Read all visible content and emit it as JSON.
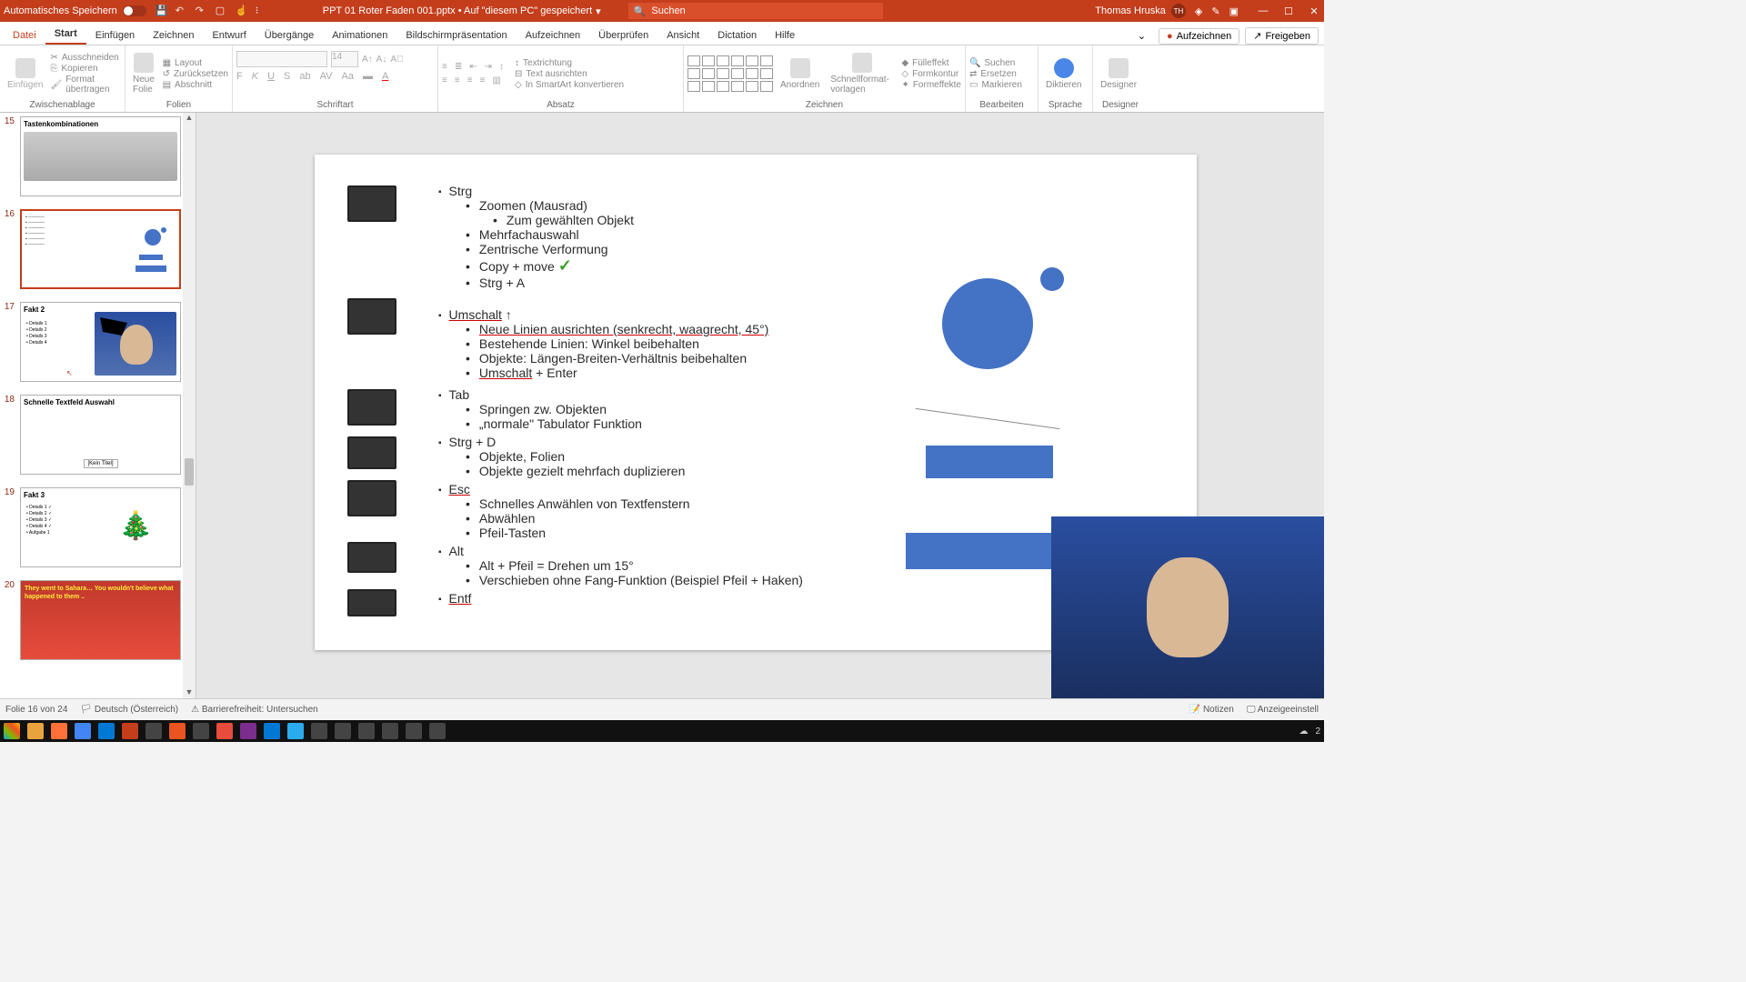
{
  "titlebar": {
    "autosave_label": "Automatisches Speichern",
    "doc_title": "PPT 01 Roter Faden 001.pptx • Auf \"diesem PC\" gespeichert",
    "search_placeholder": "Suchen",
    "user_name": "Thomas Hruska",
    "user_initials": "TH"
  },
  "tabs": {
    "file": "Datei",
    "items": [
      "Start",
      "Einfügen",
      "Zeichnen",
      "Entwurf",
      "Übergänge",
      "Animationen",
      "Bildschirmpräsentation",
      "Aufzeichnen",
      "Überprüfen",
      "Ansicht",
      "Dictation",
      "Hilfe"
    ],
    "active_index": 0,
    "record_btn": "Aufzeichnen",
    "share_btn": "Freigeben"
  },
  "ribbon": {
    "clipboard": {
      "label": "Zwischenablage",
      "paste": "Einfügen",
      "cut": "Ausschneiden",
      "copy": "Kopieren",
      "format": "Format übertragen"
    },
    "slides": {
      "label": "Folien",
      "new": "Neue Folie",
      "layout": "Layout",
      "reset": "Zurücksetzen",
      "section": "Abschnitt"
    },
    "font": {
      "label": "Schriftart",
      "size_default": "14"
    },
    "paragraph": {
      "label": "Absatz",
      "textdir": "Textrichtung",
      "textalign": "Text ausrichten",
      "smartart": "In SmartArt konvertieren"
    },
    "drawing": {
      "label": "Zeichnen",
      "arrange": "Anordnen",
      "quick": "Schnellformat-vorlagen",
      "fill": "Fülleffekt",
      "outline": "Formkontur",
      "effects": "Formeffekte"
    },
    "editing": {
      "label": "Bearbeiten",
      "find": "Suchen",
      "replace": "Ersetzen",
      "select": "Markieren"
    },
    "voice": {
      "label": "Sprache",
      "dictate": "Diktieren"
    },
    "designer": {
      "label": "Designer",
      "btn": "Designer"
    }
  },
  "thumbs": [
    {
      "num": "15",
      "title": "Tastenkombinationen"
    },
    {
      "num": "16",
      "title": ""
    },
    {
      "num": "17",
      "title": "Fakt 2"
    },
    {
      "num": "18",
      "title": "Schnelle Textfeld Auswahl",
      "badge": "[Kein Titel]"
    },
    {
      "num": "19",
      "title": "Fakt 3"
    },
    {
      "num": "20",
      "title": "They went to Sahara… You wouldn't believe what happened to them .."
    }
  ],
  "slide": {
    "strg": {
      "head": "Strg",
      "items": [
        "Zoomen (Mausrad)",
        "Mehrfachauswahl",
        "Zentrische Verformung",
        "Copy + move",
        "Strg + A"
      ],
      "sub_zoom": "Zum gewählten Objekt"
    },
    "umschalt": {
      "head": "Umschalt",
      "items": [
        "Neue Linien ausrichten (senkrecht, waagrecht, 45°)",
        "Bestehende Linien: Winkel beibehalten",
        "Objekte: Längen-Breiten-Verhältnis beibehalten",
        "Umschalt + Enter"
      ]
    },
    "tab": {
      "head": "Tab",
      "items": [
        "Springen zw. Objekten",
        "„normale\" Tabulator Funktion"
      ]
    },
    "strgd": {
      "head": "Strg + D",
      "items": [
        "Objekte, Folien",
        "Objekte gezielt mehrfach duplizieren"
      ]
    },
    "esc": {
      "head": "Esc",
      "items": [
        "Schnelles Anwählen von Textfenstern",
        "Abwählen",
        "Pfeil-Tasten"
      ]
    },
    "alt": {
      "head": "Alt",
      "items": [
        "Alt + Pfeil = Drehen um 15°",
        "Verschieben ohne Fang-Funktion (Beispiel Pfeil + Haken)"
      ]
    },
    "entf": {
      "head": "Entf"
    }
  },
  "status": {
    "slide_of": "Folie 16 von 24",
    "language": "Deutsch (Österreich)",
    "accessibility": "Barrierefreiheit: Untersuchen",
    "notes": "Notizen",
    "display": "Anzeigeeinstell"
  },
  "tray": {
    "temp": "2"
  }
}
